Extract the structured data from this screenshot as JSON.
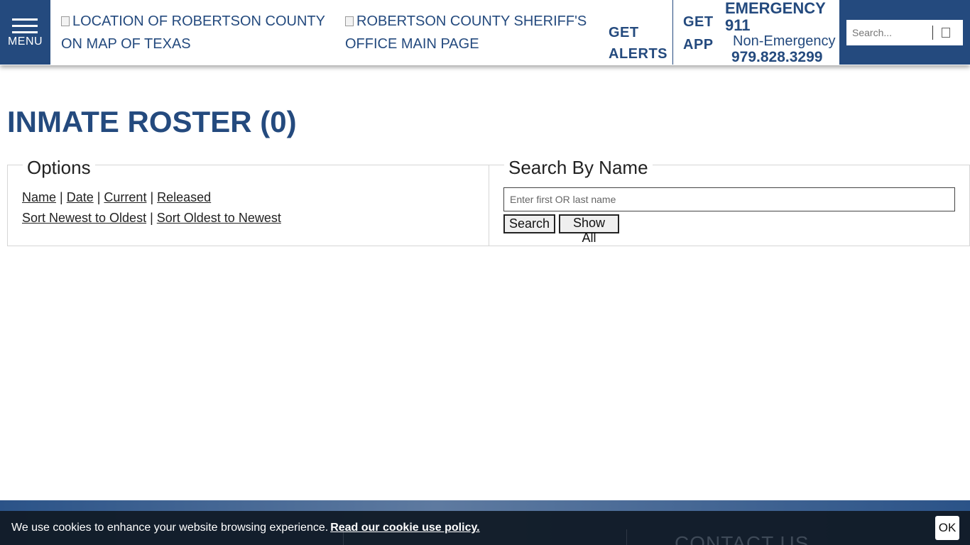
{
  "header": {
    "menu_label": "MENU",
    "map_image_alt": "LOCATION OF ROBERTSON COUNTY ON MAP OF TEXAS",
    "logo_image_alt": "ROBERTSON COUNTY SHERIFF'S OFFICE MAIN PAGE",
    "get_alerts": "GET ALERTS",
    "get_app": "GET APP",
    "emergency": "EMERGENCY 911",
    "non_emergency_label": "Non-Emergency",
    "non_emergency_phone": "979.828.3299",
    "search_placeholder": "Search...",
    "brand_color": "#244a7e"
  },
  "main": {
    "title": "INMATE ROSTER (0)",
    "options": {
      "legend": "Options",
      "sort_links": [
        "Name",
        "Date",
        "Current",
        "Released"
      ],
      "order_links": [
        "Sort Newest to Oldest",
        "Sort Oldest to Newest"
      ]
    },
    "search": {
      "legend": "Search By Name",
      "placeholder": "Enter first OR last name",
      "search_button": "Search",
      "show_all_button": "Show All"
    }
  },
  "footer": {
    "contact_heading": "CONTACT US",
    "cookie_text": "We use cookies to enhance your website browsing experience.",
    "cookie_link": "Read our cookie use policy.",
    "ok_button": "OK"
  }
}
